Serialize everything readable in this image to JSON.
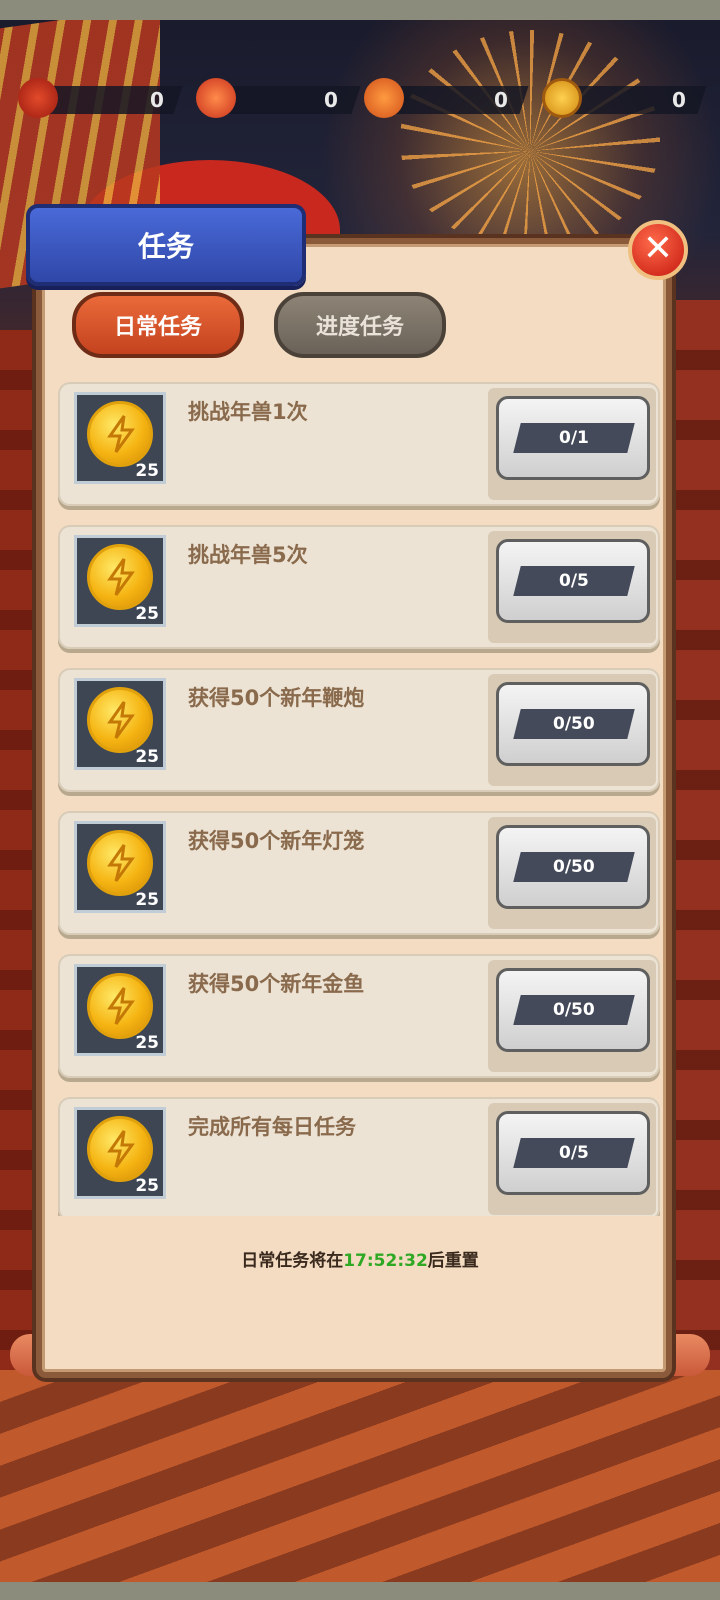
{
  "resources": [
    {
      "icon": "firecracker-icon",
      "value": "0"
    },
    {
      "icon": "lantern-icon",
      "value": "0"
    },
    {
      "icon": "goldfish-icon",
      "value": "0"
    },
    {
      "icon": "coin-icon",
      "value": "0"
    }
  ],
  "dialog": {
    "title": "任务",
    "close_label": "✕"
  },
  "tabs": {
    "daily": "日常任务",
    "progress": "进度任务"
  },
  "tasks": [
    {
      "name": "挑战年兽1次",
      "reward": "25",
      "progress": "0/1"
    },
    {
      "name": "挑战年兽5次",
      "reward": "25",
      "progress": "0/5"
    },
    {
      "name": "获得50个新年鞭炮",
      "reward": "25",
      "progress": "0/50"
    },
    {
      "name": "获得50个新年灯笼",
      "reward": "25",
      "progress": "0/50"
    },
    {
      "name": "获得50个新年金鱼",
      "reward": "25",
      "progress": "0/50"
    },
    {
      "name": "完成所有每日任务",
      "reward": "25",
      "progress": "0/5"
    }
  ],
  "reset": {
    "prefix": "日常任务将在",
    "time": "17:52:32",
    "suffix": "后重置"
  },
  "colors": {
    "accent_tab": "#d4512a",
    "title_blue": "#3a58c4",
    "timer_green": "#2fa824"
  }
}
